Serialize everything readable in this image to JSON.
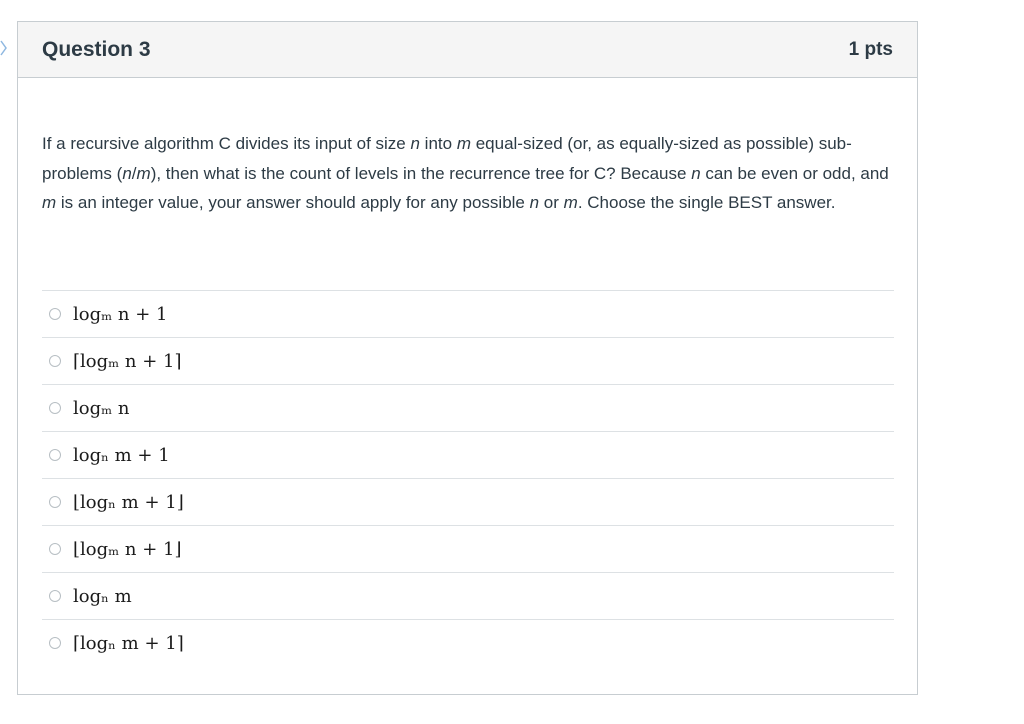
{
  "question": {
    "title": "Question 3",
    "points": "1 pts",
    "text_parts": {
      "t1": "If a recursive algorithm C divides its input of size ",
      "n": "n",
      "t2": " into ",
      "m": "m",
      "t3": " equal-sized (or, as equally-sized as possible) sub-problems (",
      "n2": "n",
      "slash": "/",
      "m2": "m",
      "t4": "), then what is the count of levels in the recurrence tree for C? Because ",
      "n3": "n",
      "t5": " can be even or odd, and ",
      "m3": "m",
      "t6": " is an integer value, your answer should apply for any possible ",
      "n4": "n",
      "t7": " or ",
      "m4": "m",
      "t8": ". Choose the single BEST answer."
    },
    "answers": [
      {
        "label": "logₘ n + 1"
      },
      {
        "label": "⌈logₘ n + 1⌉"
      },
      {
        "label": "logₘ n"
      },
      {
        "label": "logₙ m + 1"
      },
      {
        "label": "⌊logₙ m + 1⌋"
      },
      {
        "label": "⌊logₘ n + 1⌋"
      },
      {
        "label": "logₙ m"
      },
      {
        "label": "⌈logₙ m + 1⌉"
      }
    ]
  }
}
